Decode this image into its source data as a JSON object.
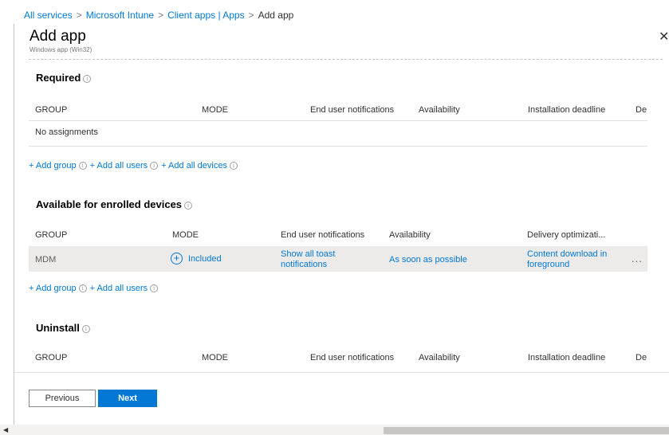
{
  "breadcrumb": {
    "items": [
      "All services",
      "Microsoft Intune",
      "Client apps | Apps"
    ],
    "current": "Add app",
    "separator": ">"
  },
  "panel": {
    "title": "Add app",
    "subtitle": "Windows app (Win32)",
    "close_glyph": "✕"
  },
  "info_glyph": "i",
  "required": {
    "heading": "Required",
    "columns": [
      "GROUP",
      "MODE",
      "End user notifications",
      "Availability",
      "Installation deadline",
      "De"
    ],
    "empty_text": "No assignments",
    "actions": [
      "+ Add group",
      "+ Add all users",
      "+ Add all devices"
    ]
  },
  "available": {
    "heading": "Available for enrolled devices",
    "columns": [
      "GROUP",
      "MODE",
      "End user notifications",
      "Availability",
      "Delivery optimizati..."
    ],
    "rows": [
      {
        "group": "MDM",
        "mode_icon": "+",
        "mode": "Included",
        "notifications": "Show all toast notifications",
        "availability": "As soon as possible",
        "delivery": "Content download in foreground",
        "more": "..."
      }
    ],
    "actions": [
      "+ Add group",
      "+ Add all users"
    ]
  },
  "uninstall": {
    "heading": "Uninstall",
    "columns": [
      "GROUP",
      "MODE",
      "End user notifications",
      "Availability",
      "Installation deadline",
      "De"
    ]
  },
  "footer": {
    "previous_label": "Previous",
    "next_label": "Next"
  },
  "colors": {
    "accent": "#0078d4",
    "text": "#323130",
    "muted": "#605e5c",
    "row_highlight": "#edebe9"
  },
  "scrollbar": {
    "left_arrow": "◀"
  }
}
